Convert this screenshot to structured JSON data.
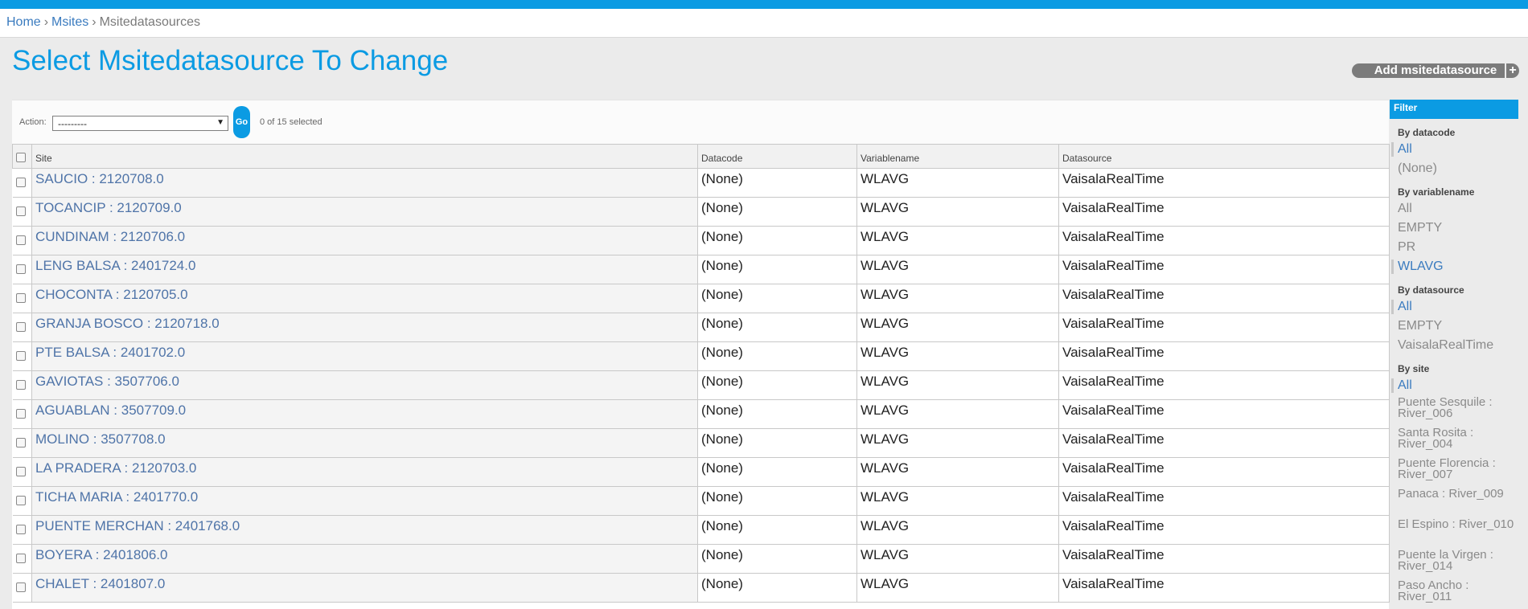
{
  "breadcrumbs": {
    "home": "Home",
    "section": "Msites",
    "current": "Msitedatasources",
    "sep": "›"
  },
  "page_title": "Select Msitedatasource To Change",
  "add_button": {
    "label": "Add msitedatasource",
    "plus": "+"
  },
  "actions": {
    "label": "Action:",
    "selected": "---------",
    "arrow": "▼",
    "go": "Go",
    "counter": "0 of 15 selected"
  },
  "table": {
    "headers": [
      "Site",
      "Datacode",
      "Variablename",
      "Datasource"
    ],
    "rows": [
      [
        "SAUCIO : 2120708.0",
        "(None)",
        "WLAVG",
        "VaisalaRealTime"
      ],
      [
        "TOCANCIP : 2120709.0",
        "(None)",
        "WLAVG",
        "VaisalaRealTime"
      ],
      [
        "CUNDINAM : 2120706.0",
        "(None)",
        "WLAVG",
        "VaisalaRealTime"
      ],
      [
        "LENG BALSA : 2401724.0",
        "(None)",
        "WLAVG",
        "VaisalaRealTime"
      ],
      [
        "CHOCONTA : 2120705.0",
        "(None)",
        "WLAVG",
        "VaisalaRealTime"
      ],
      [
        "GRANJA BOSCO : 2120718.0",
        "(None)",
        "WLAVG",
        "VaisalaRealTime"
      ],
      [
        "PTE BALSA : 2401702.0",
        "(None)",
        "WLAVG",
        "VaisalaRealTime"
      ],
      [
        "GAVIOTAS : 3507706.0",
        "(None)",
        "WLAVG",
        "VaisalaRealTime"
      ],
      [
        "AGUABLAN : 3507709.0",
        "(None)",
        "WLAVG",
        "VaisalaRealTime"
      ],
      [
        "MOLINO : 3507708.0",
        "(None)",
        "WLAVG",
        "VaisalaRealTime"
      ],
      [
        "LA PRADERA : 2120703.0",
        "(None)",
        "WLAVG",
        "VaisalaRealTime"
      ],
      [
        "TICHA MARIA : 2401770.0",
        "(None)",
        "WLAVG",
        "VaisalaRealTime"
      ],
      [
        "PUENTE MERCHAN : 2401768.0",
        "(None)",
        "WLAVG",
        "VaisalaRealTime"
      ],
      [
        "BOYERA : 2401806.0",
        "(None)",
        "WLAVG",
        "VaisalaRealTime"
      ],
      [
        "CHALET : 2401807.0",
        "(None)",
        "WLAVG",
        "VaisalaRealTime"
      ]
    ]
  },
  "filter": {
    "title": "Filter",
    "sections": [
      {
        "title": "By datacode",
        "options": [
          {
            "label": "All",
            "selected": true
          },
          {
            "label": "(None)",
            "selected": false
          }
        ]
      },
      {
        "title": "By variablename",
        "options": [
          {
            "label": "All",
            "selected": false
          },
          {
            "label": "EMPTY",
            "selected": false
          },
          {
            "label": "PR",
            "selected": false
          },
          {
            "label": "WLAVG",
            "selected": true
          }
        ]
      },
      {
        "title": "By datasource",
        "options": [
          {
            "label": "All",
            "selected": true
          },
          {
            "label": "EMPTY",
            "selected": false
          },
          {
            "label": "VaisalaRealTime",
            "selected": false
          }
        ]
      },
      {
        "title": "By site",
        "options": [
          {
            "label": "All",
            "selected": true
          },
          {
            "label": "Puente Sesquile : River_006",
            "selected": false
          },
          {
            "label": "Santa Rosita : River_004",
            "selected": false
          },
          {
            "label": "Puente Florencia : River_007",
            "selected": false
          },
          {
            "label": "Panaca : River_009",
            "selected": false
          },
          {
            "label": "El Espino : River_010",
            "selected": false
          },
          {
            "label": "Puente la Virgen : River_014",
            "selected": false
          },
          {
            "label": "Paso Ancho : River_011",
            "selected": false
          }
        ]
      }
    ]
  }
}
